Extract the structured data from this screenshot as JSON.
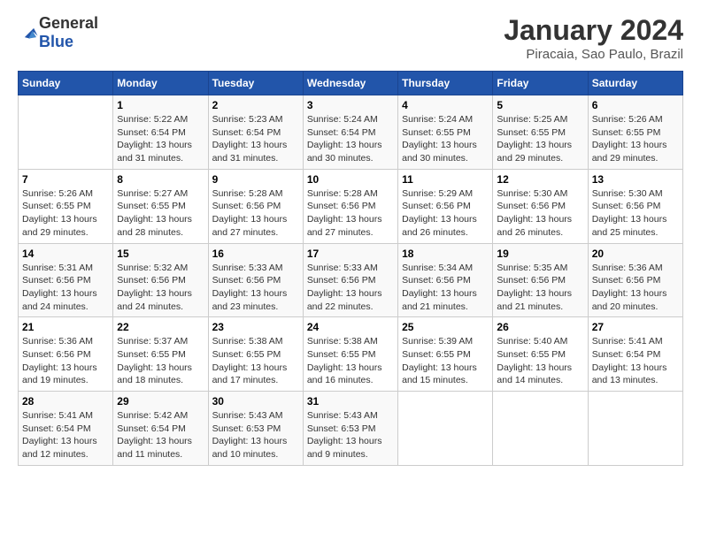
{
  "logo": {
    "general": "General",
    "blue": "Blue"
  },
  "header": {
    "title": "January 2024",
    "subtitle": "Piracaia, Sao Paulo, Brazil"
  },
  "calendar": {
    "weekdays": [
      "Sunday",
      "Monday",
      "Tuesday",
      "Wednesday",
      "Thursday",
      "Friday",
      "Saturday"
    ],
    "weeks": [
      [
        {
          "day": "",
          "info": ""
        },
        {
          "day": "1",
          "info": "Sunrise: 5:22 AM\nSunset: 6:54 PM\nDaylight: 13 hours\nand 31 minutes."
        },
        {
          "day": "2",
          "info": "Sunrise: 5:23 AM\nSunset: 6:54 PM\nDaylight: 13 hours\nand 31 minutes."
        },
        {
          "day": "3",
          "info": "Sunrise: 5:24 AM\nSunset: 6:54 PM\nDaylight: 13 hours\nand 30 minutes."
        },
        {
          "day": "4",
          "info": "Sunrise: 5:24 AM\nSunset: 6:55 PM\nDaylight: 13 hours\nand 30 minutes."
        },
        {
          "day": "5",
          "info": "Sunrise: 5:25 AM\nSunset: 6:55 PM\nDaylight: 13 hours\nand 29 minutes."
        },
        {
          "day": "6",
          "info": "Sunrise: 5:26 AM\nSunset: 6:55 PM\nDaylight: 13 hours\nand 29 minutes."
        }
      ],
      [
        {
          "day": "7",
          "info": "Sunrise: 5:26 AM\nSunset: 6:55 PM\nDaylight: 13 hours\nand 29 minutes."
        },
        {
          "day": "8",
          "info": "Sunrise: 5:27 AM\nSunset: 6:55 PM\nDaylight: 13 hours\nand 28 minutes."
        },
        {
          "day": "9",
          "info": "Sunrise: 5:28 AM\nSunset: 6:56 PM\nDaylight: 13 hours\nand 27 minutes."
        },
        {
          "day": "10",
          "info": "Sunrise: 5:28 AM\nSunset: 6:56 PM\nDaylight: 13 hours\nand 27 minutes."
        },
        {
          "day": "11",
          "info": "Sunrise: 5:29 AM\nSunset: 6:56 PM\nDaylight: 13 hours\nand 26 minutes."
        },
        {
          "day": "12",
          "info": "Sunrise: 5:30 AM\nSunset: 6:56 PM\nDaylight: 13 hours\nand 26 minutes."
        },
        {
          "day": "13",
          "info": "Sunrise: 5:30 AM\nSunset: 6:56 PM\nDaylight: 13 hours\nand 25 minutes."
        }
      ],
      [
        {
          "day": "14",
          "info": "Sunrise: 5:31 AM\nSunset: 6:56 PM\nDaylight: 13 hours\nand 24 minutes."
        },
        {
          "day": "15",
          "info": "Sunrise: 5:32 AM\nSunset: 6:56 PM\nDaylight: 13 hours\nand 24 minutes."
        },
        {
          "day": "16",
          "info": "Sunrise: 5:33 AM\nSunset: 6:56 PM\nDaylight: 13 hours\nand 23 minutes."
        },
        {
          "day": "17",
          "info": "Sunrise: 5:33 AM\nSunset: 6:56 PM\nDaylight: 13 hours\nand 22 minutes."
        },
        {
          "day": "18",
          "info": "Sunrise: 5:34 AM\nSunset: 6:56 PM\nDaylight: 13 hours\nand 21 minutes."
        },
        {
          "day": "19",
          "info": "Sunrise: 5:35 AM\nSunset: 6:56 PM\nDaylight: 13 hours\nand 21 minutes."
        },
        {
          "day": "20",
          "info": "Sunrise: 5:36 AM\nSunset: 6:56 PM\nDaylight: 13 hours\nand 20 minutes."
        }
      ],
      [
        {
          "day": "21",
          "info": "Sunrise: 5:36 AM\nSunset: 6:56 PM\nDaylight: 13 hours\nand 19 minutes."
        },
        {
          "day": "22",
          "info": "Sunrise: 5:37 AM\nSunset: 6:55 PM\nDaylight: 13 hours\nand 18 minutes."
        },
        {
          "day": "23",
          "info": "Sunrise: 5:38 AM\nSunset: 6:55 PM\nDaylight: 13 hours\nand 17 minutes."
        },
        {
          "day": "24",
          "info": "Sunrise: 5:38 AM\nSunset: 6:55 PM\nDaylight: 13 hours\nand 16 minutes."
        },
        {
          "day": "25",
          "info": "Sunrise: 5:39 AM\nSunset: 6:55 PM\nDaylight: 13 hours\nand 15 minutes."
        },
        {
          "day": "26",
          "info": "Sunrise: 5:40 AM\nSunset: 6:55 PM\nDaylight: 13 hours\nand 14 minutes."
        },
        {
          "day": "27",
          "info": "Sunrise: 5:41 AM\nSunset: 6:54 PM\nDaylight: 13 hours\nand 13 minutes."
        }
      ],
      [
        {
          "day": "28",
          "info": "Sunrise: 5:41 AM\nSunset: 6:54 PM\nDaylight: 13 hours\nand 12 minutes."
        },
        {
          "day": "29",
          "info": "Sunrise: 5:42 AM\nSunset: 6:54 PM\nDaylight: 13 hours\nand 11 minutes."
        },
        {
          "day": "30",
          "info": "Sunrise: 5:43 AM\nSunset: 6:53 PM\nDaylight: 13 hours\nand 10 minutes."
        },
        {
          "day": "31",
          "info": "Sunrise: 5:43 AM\nSunset: 6:53 PM\nDaylight: 13 hours\nand 9 minutes."
        },
        {
          "day": "",
          "info": ""
        },
        {
          "day": "",
          "info": ""
        },
        {
          "day": "",
          "info": ""
        }
      ]
    ]
  }
}
